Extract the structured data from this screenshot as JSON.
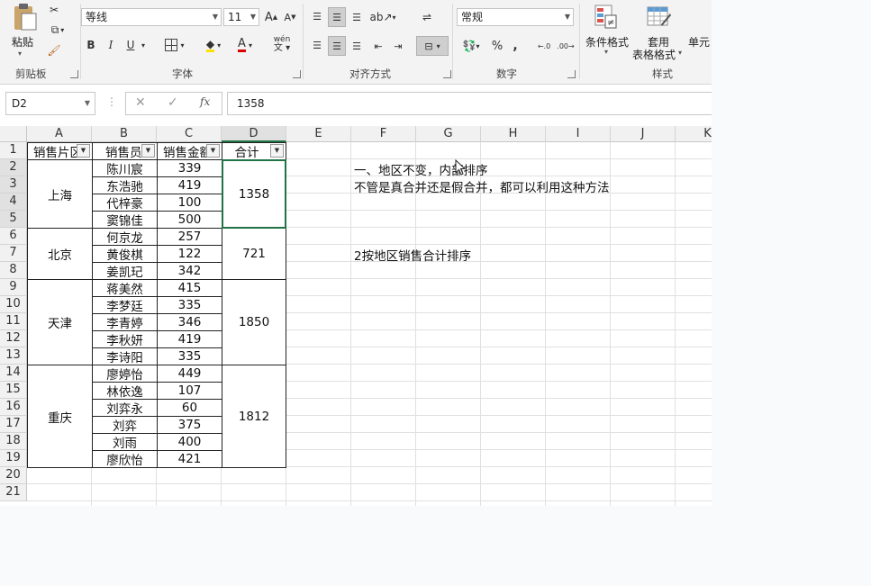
{
  "ribbon": {
    "clipboard": {
      "paste_label": "粘贴",
      "group_label": "剪贴板"
    },
    "font": {
      "name": "等线",
      "size": "11",
      "group_label": "字体",
      "bold": "B",
      "italic": "I",
      "underline": "U",
      "phonetic": "wén"
    },
    "alignment": {
      "group_label": "对齐方式"
    },
    "number": {
      "format": "常规",
      "group_label": "数字",
      "percent": "%",
      "comma": ","
    },
    "styles": {
      "conditional_format": "条件格式",
      "table_format_line1": "套用",
      "table_format_line2": "表格格式",
      "cell_styles": "单元",
      "group_label": "样式"
    }
  },
  "formula_bar": {
    "name_box": "D2",
    "fx": "fx",
    "value": "1358"
  },
  "columns": [
    "A",
    "B",
    "C",
    "D",
    "E",
    "F",
    "G",
    "H",
    "I",
    "J",
    "K"
  ],
  "rows": [
    "1",
    "2",
    "3",
    "4",
    "5",
    "6",
    "7",
    "8",
    "9",
    "10",
    "11",
    "12",
    "13",
    "14",
    "15",
    "16",
    "17",
    "18",
    "19",
    "20",
    "21"
  ],
  "table": {
    "headers": {
      "a": "销售片区",
      "b": "销售员",
      "c": "销售金额",
      "d": "合计"
    },
    "regions": [
      {
        "name": "上海",
        "total": "1358"
      },
      {
        "name": "北京",
        "total": "721"
      },
      {
        "name": "天津",
        "total": "1850"
      },
      {
        "name": "重庆",
        "total": "1812"
      }
    ],
    "rows": [
      {
        "seller": "陈川宸",
        "amount": "339"
      },
      {
        "seller": "东浩驰",
        "amount": "419"
      },
      {
        "seller": "代梓豪",
        "amount": "100"
      },
      {
        "seller": "窦锦佳",
        "amount": "500"
      },
      {
        "seller": "何京龙",
        "amount": "257"
      },
      {
        "seller": "黄俊棋",
        "amount": "122"
      },
      {
        "seller": "姜凯玘",
        "amount": "342"
      },
      {
        "seller": "蒋美然",
        "amount": "415"
      },
      {
        "seller": "李梦廷",
        "amount": "335"
      },
      {
        "seller": "李青婷",
        "amount": "346"
      },
      {
        "seller": "李秋妍",
        "amount": "419"
      },
      {
        "seller": "李诗阳",
        "amount": "335"
      },
      {
        "seller": "廖婷怡",
        "amount": "449"
      },
      {
        "seller": "林依逸",
        "amount": "107"
      },
      {
        "seller": "刘弈永",
        "amount": "60"
      },
      {
        "seller": "刘弈",
        "amount": "375"
      },
      {
        "seller": "刘雨",
        "amount": "400"
      },
      {
        "seller": "廖欣怡",
        "amount": "421"
      }
    ]
  },
  "notes": {
    "note1": "一、地区不变，内部排序",
    "note2": "不管是真合并还是假合并，都可以利用这种方法",
    "note3": "2按地区销售合计排序"
  }
}
